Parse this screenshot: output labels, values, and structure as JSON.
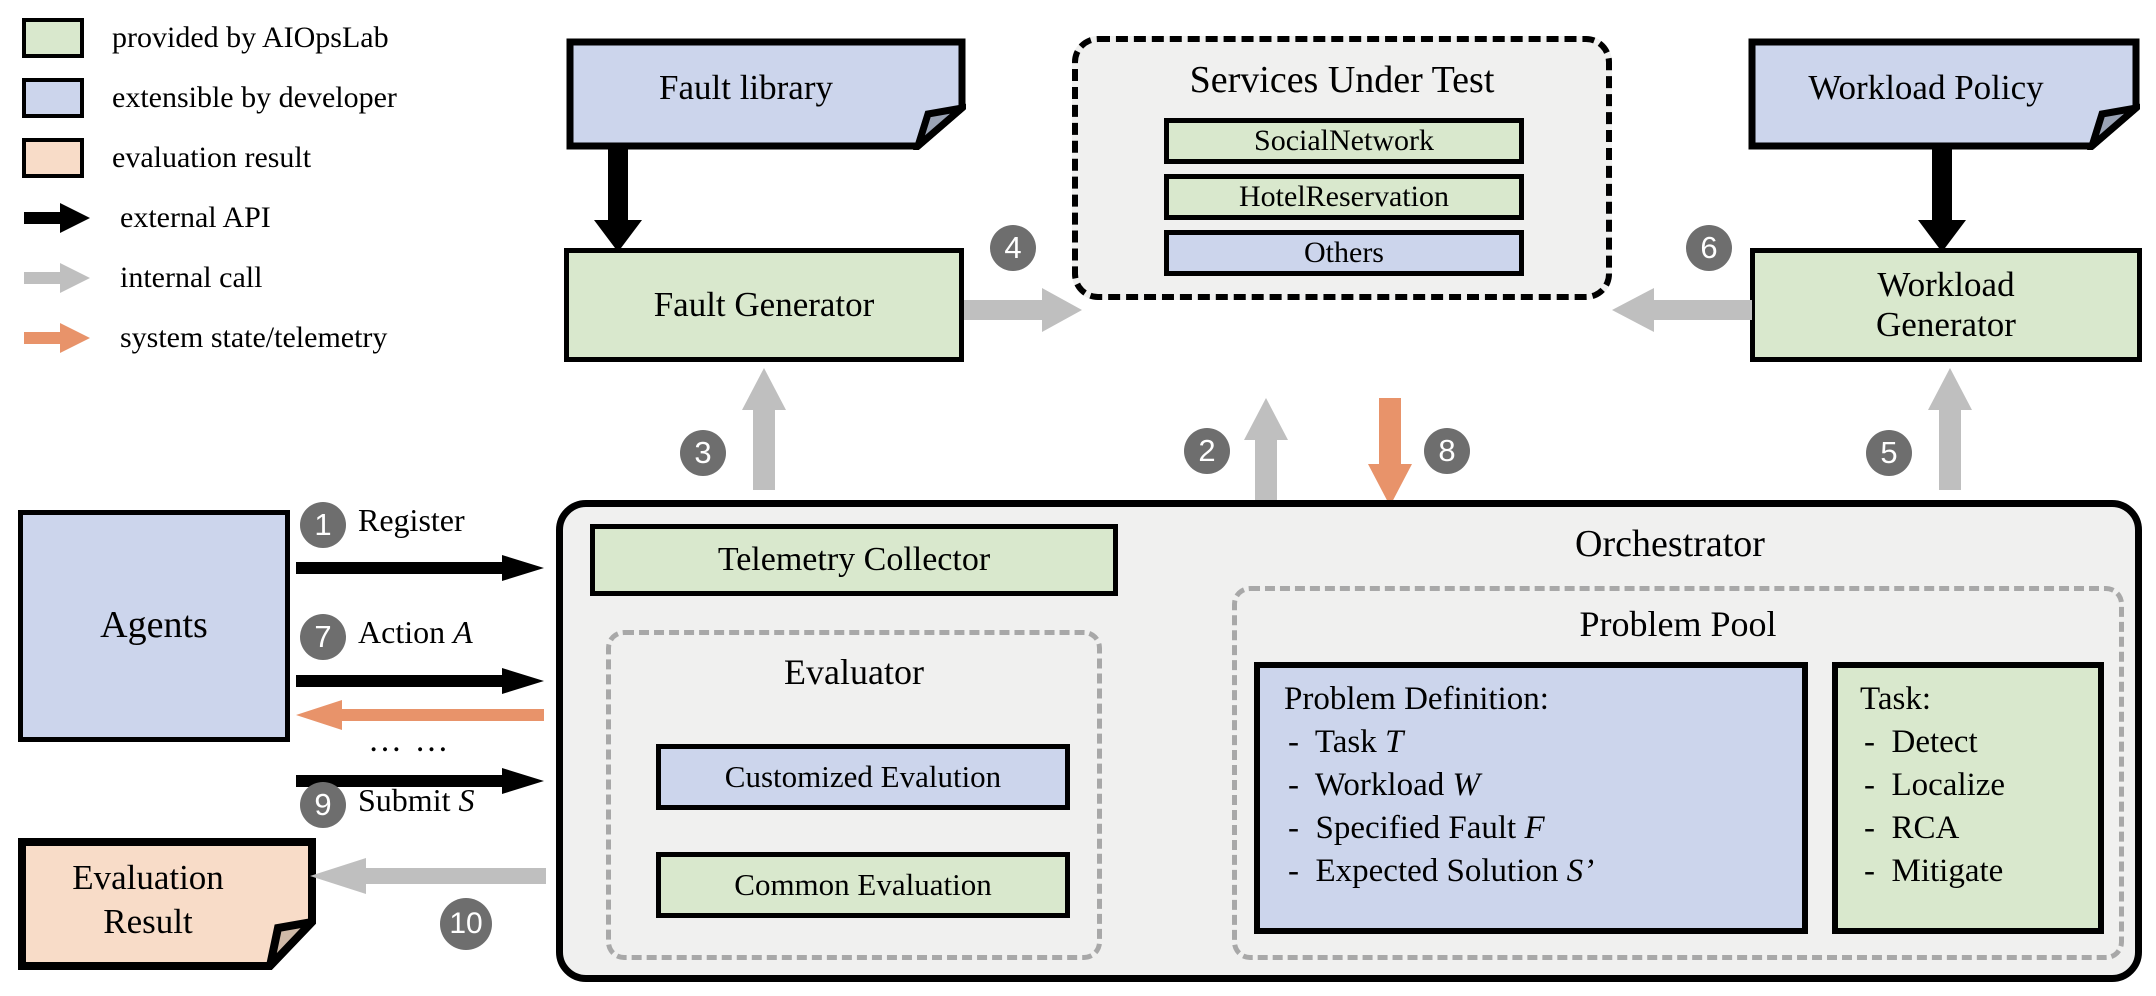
{
  "legend": {
    "items": [
      {
        "kind": "swatch",
        "color": "#d9e8cd",
        "label": "provided by AIOpsLab"
      },
      {
        "kind": "swatch",
        "color": "#ccd5ec",
        "label": "extensible by developer"
      },
      {
        "kind": "swatch",
        "color": "#f8dcc8",
        "label": "evaluation result"
      },
      {
        "kind": "arrow",
        "color": "#000000",
        "label": "external API"
      },
      {
        "kind": "arrow",
        "color": "#bfbfbf",
        "label": "internal call"
      },
      {
        "kind": "arrow",
        "color": "#e8936a",
        "label": "system state/telemetry"
      }
    ]
  },
  "nodes": {
    "fault_library": "Fault library",
    "fault_generator": "Fault Generator",
    "workload_policy": "Workload Policy",
    "workload_generator": "Workload\nGenerator",
    "workload_generator_line1": "Workload",
    "workload_generator_line2": "Generator",
    "agents": "Agents",
    "evaluation_result_line1": "Evaluation",
    "evaluation_result_line2": "Result",
    "telemetry_collector": "Telemetry Collector"
  },
  "services_under_test": {
    "title": "Services Under Test",
    "services": [
      {
        "name": "SocialNetwork",
        "color": "#d9e8cd"
      },
      {
        "name": "HotelReservation",
        "color": "#d9e8cd"
      },
      {
        "name": "Others",
        "color": "#ccd5ec"
      }
    ]
  },
  "orchestrator": {
    "title": "Orchestrator",
    "evaluator": {
      "title": "Evaluator",
      "items": [
        {
          "name": "Customized Evalution",
          "color": "#ccd5ec"
        },
        {
          "name": "Common Evaluation",
          "color": "#d9e8cd"
        }
      ]
    },
    "problem_pool": {
      "title": "Problem Pool",
      "problem_definition": {
        "heading": "Problem Definition:",
        "items": [
          "Task T",
          "Workload W",
          "Specified Fault F",
          "Expected Solution S’"
        ],
        "items_plain": [
          "Task ",
          "Workload ",
          "Specified Fault ",
          "Expected Solution "
        ],
        "items_var": [
          "T",
          "W",
          "F",
          "S’"
        ]
      },
      "task": {
        "heading": "Task:",
        "items": [
          "Detect",
          "Localize",
          "RCA",
          "Mitigate"
        ]
      }
    }
  },
  "sequence": {
    "step1": {
      "num": "1",
      "label": "Register"
    },
    "step2": {
      "num": "2",
      "label": ""
    },
    "step3": {
      "num": "3",
      "label": ""
    },
    "step4": {
      "num": "4",
      "label": ""
    },
    "step5": {
      "num": "5",
      "label": ""
    },
    "step6": {
      "num": "6",
      "label": ""
    },
    "step7": {
      "num": "7",
      "label": "Action A",
      "label_plain": "Action ",
      "label_var": "A"
    },
    "step8": {
      "num": "8",
      "label": ""
    },
    "step9": {
      "num": "9",
      "label": "Submit S",
      "label_plain": "Submit ",
      "label_var": "S"
    },
    "step10": {
      "num": "10",
      "label": ""
    },
    "ellipsis": "… …"
  },
  "colors": {
    "green": "#d9e8cd",
    "blue": "#ccd5ec",
    "peach": "#f8dcc8",
    "gray_arrow": "#bfbfbf",
    "orange_arrow": "#e8936a",
    "badge": "#6e6e6e",
    "panel": "#f0f0ef"
  }
}
